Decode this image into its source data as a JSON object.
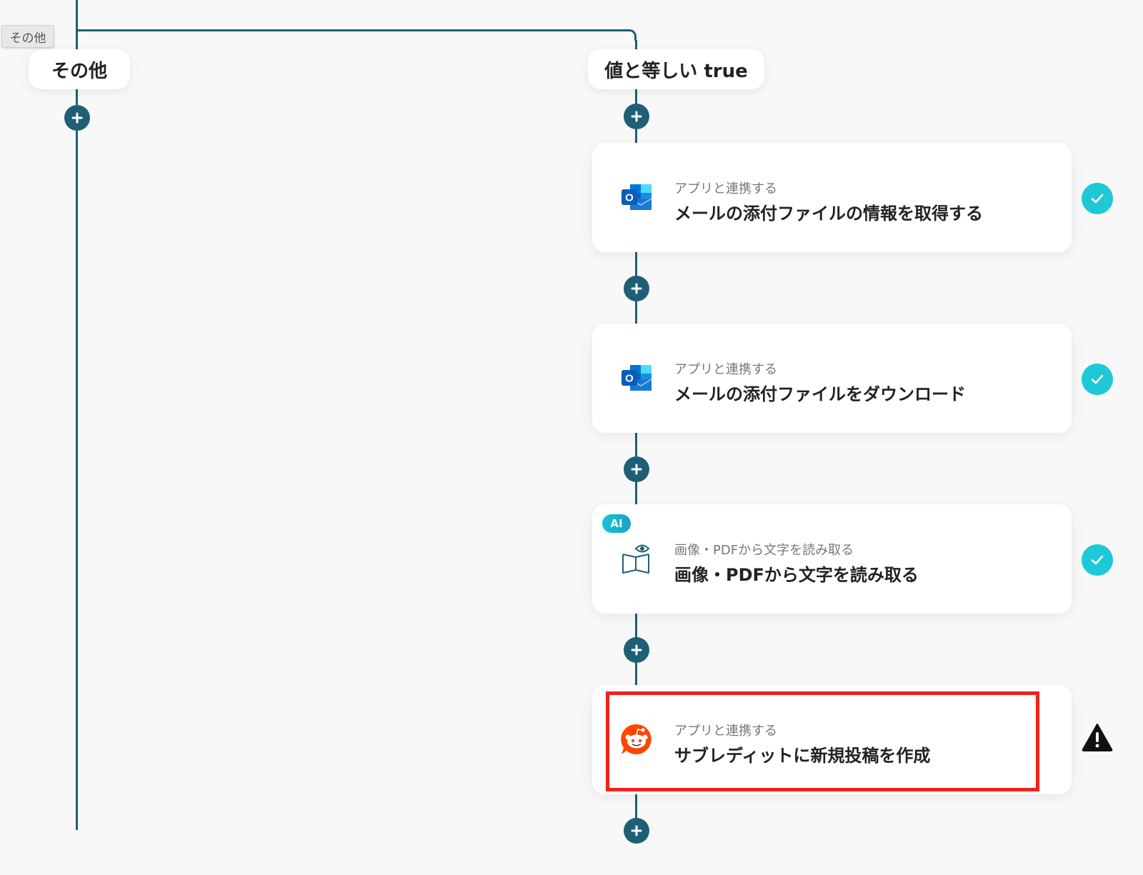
{
  "tag": {
    "label": "その他"
  },
  "branches": {
    "left": {
      "label": "その他"
    },
    "right": {
      "label": "値と等しい true"
    }
  },
  "steps": [
    {
      "category": "アプリと連携する",
      "title": "メールの添付ファイルの情報を取得する",
      "app_icon": "outlook-icon",
      "status": "complete"
    },
    {
      "category": "アプリと連携する",
      "title": "メールの添付ファイルをダウンロード",
      "app_icon": "outlook-icon",
      "status": "complete"
    },
    {
      "category": "画像・PDFから文字を読み取る",
      "title": "画像・PDFから文字を読み取る",
      "app_icon": "ocr-book-eye-icon",
      "badge": "AI",
      "status": "complete"
    },
    {
      "category": "アプリと連携する",
      "title": "サブレディットに新規投稿を作成",
      "app_icon": "reddit-icon",
      "status": "warning",
      "highlighted": true
    }
  ],
  "colors": {
    "connector": "#1e5f76",
    "check": "#1ec8d8",
    "highlight": "#f0221a",
    "outlook": "#0a64c8",
    "reddit": "#ff4500"
  }
}
